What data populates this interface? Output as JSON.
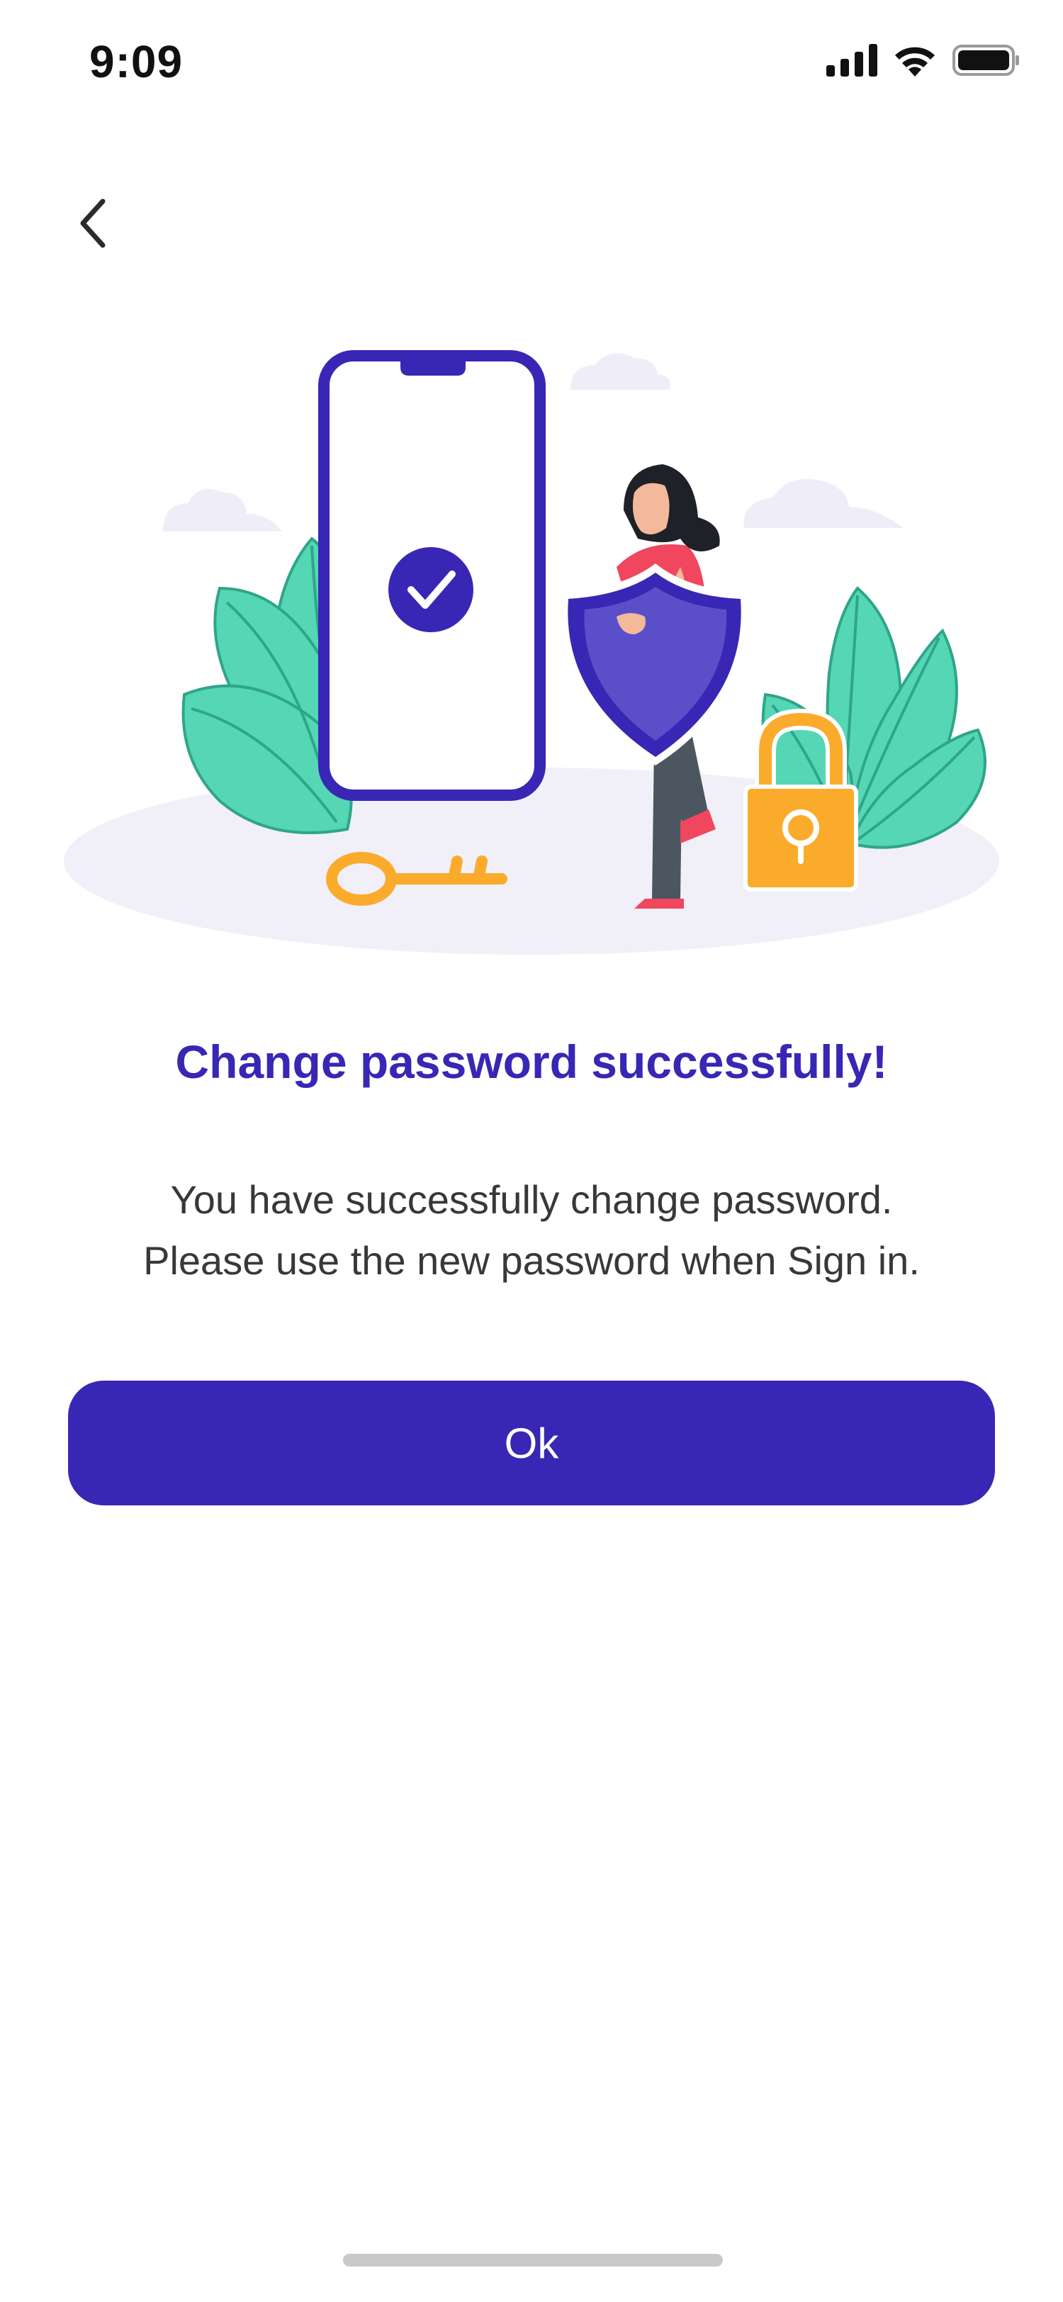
{
  "status_bar": {
    "time": "9:09",
    "icons": [
      "signal-icon",
      "wifi-icon",
      "battery-icon"
    ]
  },
  "navigation": {
    "back_icon": "chevron-left-icon"
  },
  "illustration": {
    "subject": "security-illustration",
    "colors": {
      "phone": "#3827b4",
      "shield": "#5a4fc8",
      "leaves": "#55d6b4",
      "lock": "#fbab2c",
      "key": "#fbab2c",
      "shirt": "#f0465e",
      "ground": "#f1f0f8"
    }
  },
  "content": {
    "title": "Change password successfully!",
    "message_line1": "You have successfully change password.",
    "message_line2": "Please use the new password when Sign in."
  },
  "actions": {
    "ok_label": "Ok"
  },
  "theme": {
    "accent": "#3827b4",
    "text": "#383838",
    "background": "#ffffff"
  }
}
